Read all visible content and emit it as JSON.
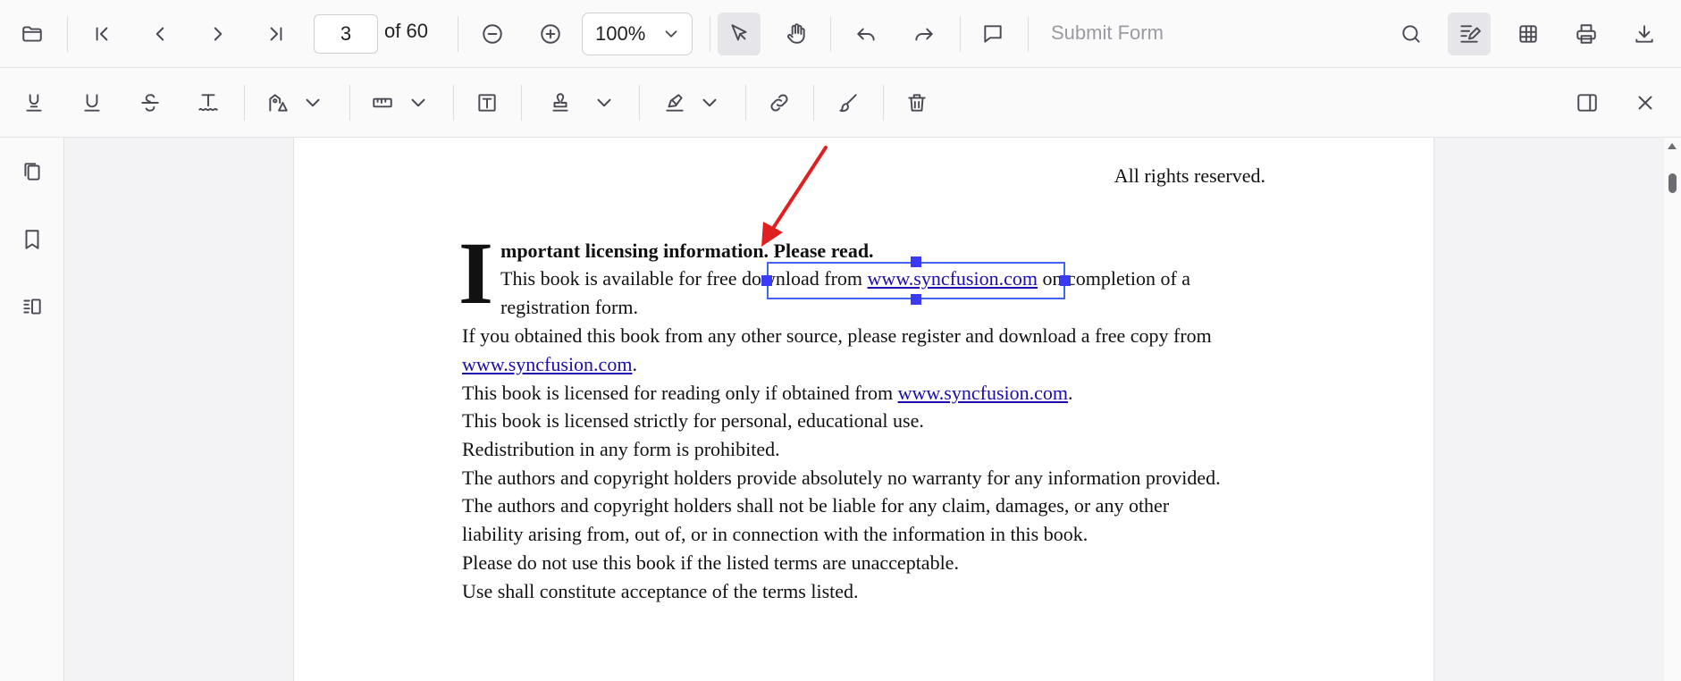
{
  "toolbar": {
    "page_number": "3",
    "page_of": "of 60",
    "zoom_value": "100%",
    "submit_form_label": "Submit Form"
  },
  "document": {
    "rights": "All rights reserved.",
    "dropcap": "I",
    "heading": "mportant licensing information. Please read.",
    "line1_pre": "This book is available for free download from ",
    "line1_link": "www.syncfusion.com",
    "line1_post": " on completion of a",
    "line2": "registration form.",
    "line3": "If you obtained this book from any other source, please register and download a free copy from",
    "line4_link": "www.syncfusion.com",
    "line4_post": ".",
    "line5_pre": "This book is licensed for reading only if obtained from ",
    "line5_link": "www.syncfusion.com",
    "line5_post": ".",
    "line6": "This book is licensed strictly for personal, educational use.",
    "line7": "Redistribution in any form is prohibited.",
    "line8": "The authors and copyright holders provide absolutely no warranty for any information provided.",
    "line9": "The authors and copyright holders shall not be liable for any claim, damages, or any other",
    "line10": "liability arising from, out of, or in connection with the information in this book.",
    "line11": "Please do not use this book if the listed terms are unacceptable.",
    "line12": "Use shall constitute acceptance of the terms listed."
  },
  "colors": {
    "selection": "#4466ee",
    "handle": "#3b3bf5",
    "arrow": "#e02020",
    "link": "#1a0dab"
  },
  "icons": {
    "open": "folder-icon",
    "first_page": "first-page-icon",
    "prev_page": "previous-page-icon",
    "next_page": "next-page-icon",
    "last_page": "last-page-icon",
    "zoom_out": "zoom-out-icon",
    "zoom_in": "zoom-in-icon",
    "select": "pointer-icon",
    "pan": "hand-icon",
    "undo": "undo-icon",
    "redo": "redo-icon",
    "comment": "comment-icon",
    "search": "search-icon",
    "annotation": "annotation-icon",
    "form_designer": "form-designer-icon",
    "print": "print-icon",
    "download": "download-icon"
  }
}
